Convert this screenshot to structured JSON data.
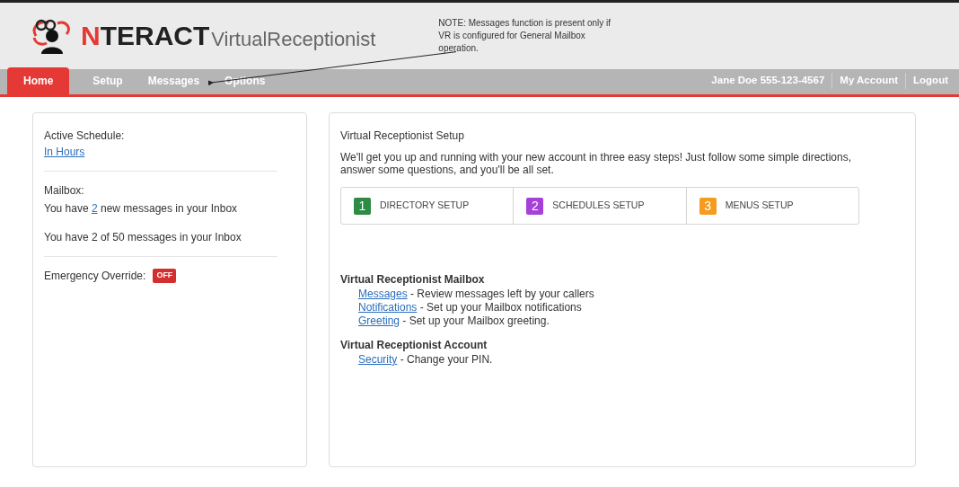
{
  "logo": {
    "accent": "N",
    "brand": "TERACT",
    "product": "VirtualReceptionist"
  },
  "note": "NOTE: Messages function is present only if VR is configured for General Mailbox operation.",
  "tabs": [
    {
      "label": "Home",
      "selected": true
    },
    {
      "label": "Setup",
      "selected": false
    },
    {
      "label": "Messages",
      "selected": false
    },
    {
      "label": "Options",
      "selected": false
    }
  ],
  "user_links": [
    "Jane Doe 555-123-4567",
    "My Account",
    "Logout"
  ],
  "status_panel": {
    "schedule_label": "Active Schedule:",
    "schedule_link": "In Hours",
    "mailbox_label": "Mailbox:",
    "new_messages": {
      "before": "You have ",
      "link": "2",
      "after": " new messages in your Inbox"
    },
    "total_messages": "You have 2 of 50 messages in your Inbox",
    "override_label": "Emergency Override:",
    "override": {
      "label": "OFF",
      "on": false
    }
  },
  "setup": {
    "title": "Virtual Receptionist Setup",
    "intro": "We'll get you up and running with your new account in three easy steps! Just follow some simple directions, answer some questions, and you'll be all set.",
    "steps": [
      {
        "number": "1",
        "label": "DIRECTORY SETUP",
        "color": "#2e8b43"
      },
      {
        "number": "2",
        "label": "SCHEDULES SETUP",
        "color": "#a540d8"
      },
      {
        "number": "3",
        "label": "MENUS SETUP",
        "color": "#f39c1f"
      }
    ]
  },
  "sections": [
    {
      "title": "Virtual Receptionist Mailbox",
      "items": [
        {
          "link": "Messages",
          "text": " - Review messages left by your callers"
        },
        {
          "link": "Notifications",
          "text": " - Set up your Mailbox notifications"
        },
        {
          "link": "Greeting",
          "text": " - Set up your Mailbox greeting."
        }
      ]
    },
    {
      "title": "Virtual Receptionist Account",
      "items": [
        {
          "link": "Security",
          "text": " - Change your PIN."
        }
      ]
    }
  ]
}
